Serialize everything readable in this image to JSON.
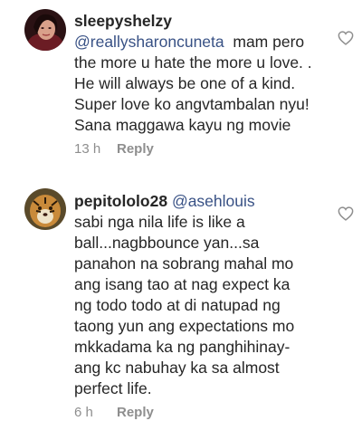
{
  "comments": [
    {
      "username": "sleepyshelzy",
      "inline_prefix": "",
      "mention": "@reallysharoncuneta",
      "first_line_rest": "  mam pero",
      "lines": [
        "the more u hate the more u love. .",
        "He will always be one of a kind.",
        "Super love ko angvtambalan nyu!",
        "Sana maggawa kayu ng movie"
      ],
      "time": "13 h",
      "reply_label": "Reply",
      "avatar_icon": "user-photo-woman"
    },
    {
      "username": "pepitololo28",
      "mention": "@asehlouis",
      "lines": [
        "sabi nga nila life is like a",
        "ball...nagbbounce yan...sa",
        "panahon na sobrang mahal mo",
        "ang isang tao at nag expect ka",
        "ng todo todo at di natupad ng",
        "taong yun ang expectations mo",
        "mkkadama ka ng panghihinay-",
        "ang kc nabuhay ka sa almost",
        "perfect life."
      ],
      "time": "6 h",
      "reply_label": "Reply",
      "avatar_icon": "user-photo-tiger"
    }
  ],
  "icons": {
    "like": "heart-outline-icon"
  },
  "colors": {
    "text": "#262626",
    "mention": "#385185",
    "meta": "#8e8e8e"
  }
}
